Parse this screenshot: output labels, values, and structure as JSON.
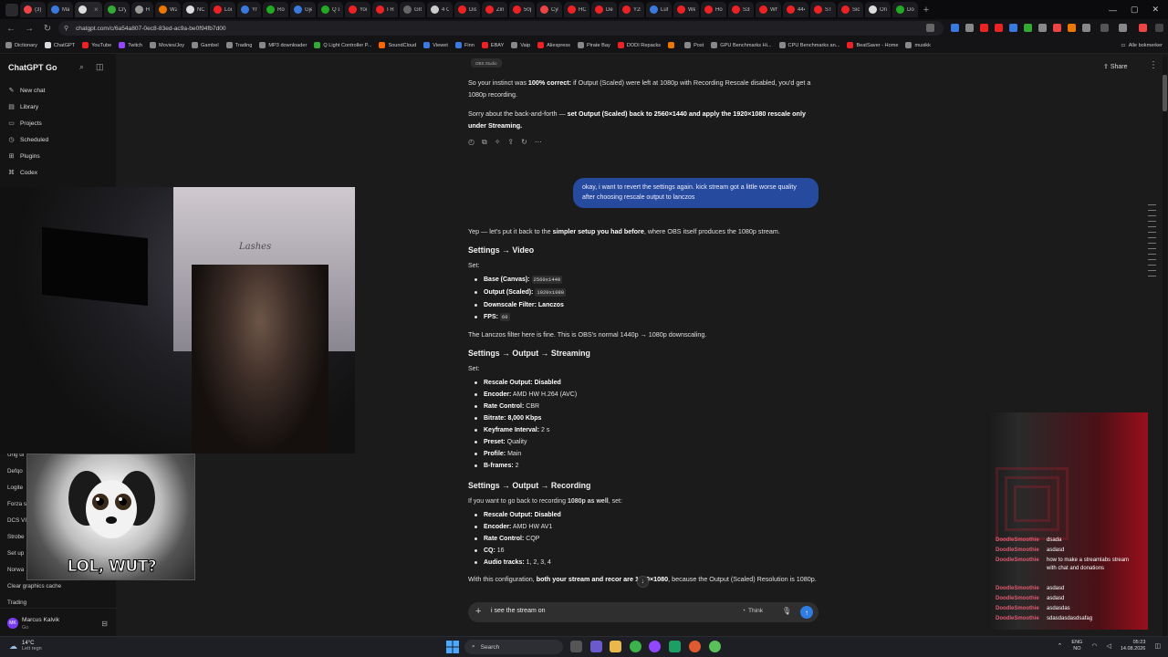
{
  "browser": {
    "tabs": [
      {
        "label": "(3) I",
        "color": "#e44"
      },
      {
        "label": "Ma",
        "color": "#3a7ae0"
      },
      {
        "label": "",
        "color": "#ddd",
        "active": true
      },
      {
        "label": "Cry",
        "color": "#3a3"
      },
      {
        "label": "H",
        "color": "#999"
      },
      {
        "label": "W2",
        "color": "#e70"
      },
      {
        "label": "NÖ",
        "color": "#ddd"
      },
      {
        "label": "Lou",
        "color": "#e22"
      },
      {
        "label": "Yr",
        "color": "#3a7ae0"
      },
      {
        "label": "Roc",
        "color": "#2a2"
      },
      {
        "label": "Gje",
        "color": "#3a7ae0"
      },
      {
        "label": "Q Li",
        "color": "#2a2"
      },
      {
        "label": "You",
        "color": "#e22"
      },
      {
        "label": "I Re",
        "color": "#e22"
      },
      {
        "label": "GIC",
        "color": "#666"
      },
      {
        "label": "4 C",
        "color": "#ccc"
      },
      {
        "label": "Dist",
        "color": "#e22"
      },
      {
        "label": "Zink",
        "color": "#e22"
      },
      {
        "label": "50p",
        "color": "#e22"
      },
      {
        "label": "Cyb",
        "color": "#e44"
      },
      {
        "label": "HCl",
        "color": "#e22"
      },
      {
        "label": "Deli",
        "color": "#e22"
      },
      {
        "label": "Y2k",
        "color": "#e22"
      },
      {
        "label": "Luft",
        "color": "#3a7ae0"
      },
      {
        "label": "We",
        "color": "#e22"
      },
      {
        "label": "Hou",
        "color": "#e22"
      },
      {
        "label": "S3F",
        "color": "#e22"
      },
      {
        "label": "Wh",
        "color": "#e22"
      },
      {
        "label": "444",
        "color": "#e22"
      },
      {
        "label": "STR",
        "color": "#e22"
      },
      {
        "label": "Sicc",
        "color": "#e22"
      },
      {
        "label": "Onl",
        "color": "#ddd"
      },
      {
        "label": "Doo",
        "color": "#2a2"
      }
    ],
    "close_glyph": "×",
    "new_tab": "+",
    "url": "chatgpt.com/c/6a54a807-0ec8-83ed-ac9a-be0f94fb7d00",
    "bookmarks": [
      {
        "label": "Dictionary",
        "color": "#888"
      },
      {
        "label": "ChatGPT",
        "color": "#ddd"
      },
      {
        "label": "YouTube",
        "color": "#e22"
      },
      {
        "label": "Twitch",
        "color": "#9146ff"
      },
      {
        "label": "Movies/Joy",
        "color": "#888"
      },
      {
        "label": "Gambel",
        "color": "#888"
      },
      {
        "label": "Trading",
        "color": "#888"
      },
      {
        "label": "MP3 downloader",
        "color": "#888"
      },
      {
        "label": "Q Light Controller P...",
        "color": "#3a3"
      },
      {
        "label": "SoundCloud",
        "color": "#f60"
      },
      {
        "label": "Viewet",
        "color": "#3a7ae0"
      },
      {
        "label": "Finn",
        "color": "#3a7ae0"
      },
      {
        "label": "EBAY",
        "color": "#e22"
      },
      {
        "label": "Vaip",
        "color": "#888"
      },
      {
        "label": "Aliexpress",
        "color": "#e22"
      },
      {
        "label": "Pirate Bay",
        "color": "#888"
      },
      {
        "label": "DODI Repacks",
        "color": "#e22"
      },
      {
        "label": "",
        "color": "#e70"
      },
      {
        "label": "Post",
        "color": "#888"
      },
      {
        "label": "GPU Benchmarks Hi...",
        "color": "#888"
      },
      {
        "label": "CPU Benchmarks an...",
        "color": "#888"
      },
      {
        "label": "BeatSaver - Home",
        "color": "#e22"
      },
      {
        "label": "musikk",
        "color": "#888"
      }
    ],
    "all_bookmarks": "Alle bokmerker"
  },
  "sidebar": {
    "brand": "ChatGPT Go",
    "nav": [
      {
        "label": "New chat",
        "icon": "pencil-icon"
      },
      {
        "label": "Library",
        "icon": "library-icon"
      },
      {
        "label": "Projects",
        "icon": "folder-icon"
      },
      {
        "label": "Scheduled",
        "icon": "clock-icon"
      },
      {
        "label": "Plugins",
        "icon": "plugin-icon"
      },
      {
        "label": "Codex",
        "icon": "codex-icon"
      }
    ],
    "recents": [
      "Ung uf",
      "Defqo",
      "Logite",
      "Forza s",
      "DCS VI",
      "Strobe",
      "Set up",
      "Norwa",
      "Clear graphics cache",
      "Trading"
    ],
    "account": {
      "initials": "MK",
      "name": "Marcus Kalvik",
      "plan": "Go"
    }
  },
  "header": {
    "share": "Share"
  },
  "chat": {
    "chip": "OBS Studio",
    "p1_a": "So your instinct was ",
    "p1_b": "100% correct:",
    "p1_c": " if Output (Scaled) were left at 1080p with Recording Rescale disabled, you'd get a 1080p recording.",
    "p2_a": "Sorry about the back-and-forth — ",
    "p2_b": "set Output (Scaled) back to 2560×1440 and apply the 1920×1080 rescale only under Streaming.",
    "user_message": "okay, i want to revert the settings again. kick stream got a little worse quality after choosing rescale output to lanczos",
    "intro_a": "Yep — let's put it back to the ",
    "intro_b": "simpler setup you had before",
    "intro_c": ", where OBS itself produces the 1080p stream.",
    "video_heading": "Settings → Video",
    "video_set": "Set:",
    "video_items": [
      {
        "k": "Base (Canvas): ",
        "code": "2560x1440"
      },
      {
        "k": "Output (Scaled): ",
        "code": "1920x1080"
      },
      {
        "k": "Downscale Filter: Lanczos",
        "code": ""
      },
      {
        "k": "FPS: ",
        "code": "60"
      }
    ],
    "video_note": "The Lanczos filter here is fine. This is OBS's normal 1440p → 1080p downscaling.",
    "stream_heading": "Settings → Output → Streaming",
    "stream_set": "Set:",
    "stream_items": [
      {
        "k": "Rescale Output: Disabled",
        "v": ""
      },
      {
        "k": "Encoder:",
        "v": " AMD HW H.264 (AVC)"
      },
      {
        "k": "Rate Control:",
        "v": " CBR"
      },
      {
        "k": "Bitrate: 8,000 Kbps",
        "v": ""
      },
      {
        "k": "Keyframe Interval:",
        "v": " 2 s"
      },
      {
        "k": "Preset:",
        "v": " Quality"
      },
      {
        "k": "Profile:",
        "v": " Main"
      },
      {
        "k": "B-frames:",
        "v": " 2"
      }
    ],
    "rec_heading": "Settings → Output → Recording",
    "rec_intro_a": "If you want to go back to recording ",
    "rec_intro_b": "1080p as well",
    "rec_intro_c": ", set:",
    "rec_items": [
      {
        "k": "Rescale Output: Disabled",
        "v": ""
      },
      {
        "k": "Encoder:",
        "v": " AMD HW AV1"
      },
      {
        "k": "Rate Control:",
        "v": " CQP"
      },
      {
        "k": "CQ:",
        "v": " 16"
      },
      {
        "k": "Audio tracks:",
        "v": " 1, 2, 3, 4"
      }
    ],
    "final_a": "With this configuration, ",
    "final_b": "both your stream and recor",
    "final_c": " are 1920×1080",
    "final_d": ", because the Output (Scaled) Resolution is 1080p."
  },
  "composer": {
    "text": "i see the stream on",
    "think": "Think"
  },
  "overlays": {
    "webcam_sign": "Lashes",
    "dog_caption": "LOL, WUT?",
    "chat": [
      {
        "user": "DoodleSmoothie",
        "msg": "dsada"
      },
      {
        "user": "DoodleSmoothie",
        "msg": "asdasd"
      },
      {
        "user": "DoodleSmoothie",
        "msg": "how to make a streamlabs stream with chat and donations"
      },
      {
        "user": "DoodleSmoothie",
        "msg": "asdasd"
      },
      {
        "user": "DoodleSmoothie",
        "msg": "asdasd"
      },
      {
        "user": "DoodleSmoothie",
        "msg": "asdasdas"
      },
      {
        "user": "DoodleSmoothie",
        "msg": "sdasdasdasdsafag"
      }
    ]
  },
  "taskbar": {
    "temp": "14°C",
    "weather": "Lett regn",
    "search": "Search",
    "lang1": "ENG",
    "lang2": "NO",
    "time": "05:23",
    "date": "14.08.2026"
  }
}
